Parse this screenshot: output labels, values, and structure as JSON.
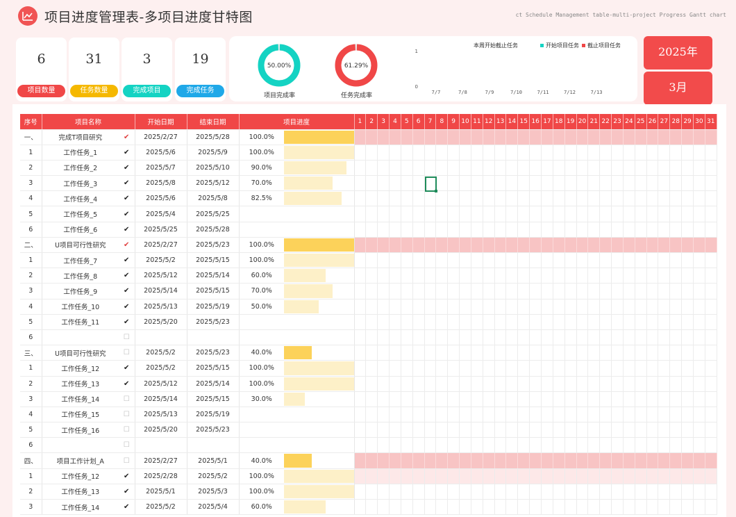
{
  "header": {
    "title": "项目进度管理表-多项目进度甘特图",
    "subtitle": "ct Schedule Management table-multi-project Progress Gantt chart"
  },
  "kpis": [
    {
      "value": "6",
      "label": "项目数量",
      "color": "#f04747"
    },
    {
      "value": "31",
      "label": "任务数量",
      "color": "#f5b800"
    },
    {
      "value": "3",
      "label": "完成项目",
      "color": "#14d3c3"
    },
    {
      "value": "19",
      "label": "完成任务",
      "color": "#1fa8e8"
    }
  ],
  "donuts": [
    {
      "value_text": "50.00%",
      "fraction": 0.5,
      "label": "项目完成率",
      "color": "#14d3c3"
    },
    {
      "value_text": "61.29%",
      "fraction": 0.6129,
      "label": "任务完成率",
      "color": "#f04747"
    }
  ],
  "chart_data": {
    "type": "bar",
    "title": "本周开始截止任务",
    "categories": [
      "7/7",
      "7/8",
      "7/9",
      "7/10",
      "7/11",
      "7/12",
      "7/13"
    ],
    "series": [
      {
        "name": "开始项目任务",
        "values": [
          0,
          0,
          0,
          0,
          0,
          0,
          0
        ],
        "color": "#14d3c3"
      },
      {
        "name": "截止项目任务",
        "values": [
          0,
          0,
          0,
          0,
          0,
          0,
          0
        ],
        "color": "#f04747"
      }
    ],
    "yticks": [
      "1",
      "0"
    ],
    "ylim": [
      0,
      1
    ]
  },
  "date": {
    "year": "2025年",
    "month": "3月"
  },
  "table": {
    "columns": [
      "序号",
      "项目名称",
      "开始日期",
      "结束日期",
      "项目进度"
    ],
    "days": [
      "1",
      "2",
      "3",
      "4",
      "5",
      "6",
      "7",
      "8",
      "9",
      "10",
      "11",
      "12",
      "13",
      "14",
      "15",
      "16",
      "17",
      "18",
      "19",
      "20",
      "21",
      "22",
      "23",
      "24",
      "25",
      "26",
      "27",
      "28",
      "29",
      "30",
      "31"
    ],
    "rows": [
      {
        "idx": "一、",
        "name": "完成T项目研究",
        "check": "✔",
        "check_color": "#e04040",
        "start": "2025/2/27",
        "end": "2025/5/28",
        "pct": "100.0%",
        "progress": 1.0,
        "group": true
      },
      {
        "idx": "1",
        "name": "工作任务_1",
        "check": "✔",
        "start": "2025/5/6",
        "end": "2025/5/9",
        "pct": "100.0%",
        "progress": 1.0
      },
      {
        "idx": "2",
        "name": "工作任务_2",
        "check": "✔",
        "start": "2025/5/7",
        "end": "2025/5/10",
        "pct": "90.0%",
        "progress": 0.9
      },
      {
        "idx": "3",
        "name": "工作任务_3",
        "check": "✔",
        "start": "2025/5/8",
        "end": "2025/5/12",
        "pct": "70.0%",
        "progress": 0.7
      },
      {
        "idx": "4",
        "name": "工作任务_4",
        "check": "✔",
        "start": "2025/5/6",
        "end": "2025/5/8",
        "pct": "82.5%",
        "progress": 0.825
      },
      {
        "idx": "5",
        "name": "工作任务_5",
        "check": "✔",
        "start": "2025/5/4",
        "end": "2025/5/25",
        "pct": "",
        "progress": 0
      },
      {
        "idx": "6",
        "name": "工作任务_6",
        "check": "✔",
        "start": "2025/5/25",
        "end": "2025/5/28",
        "pct": "",
        "progress": 0
      },
      {
        "idx": "二、",
        "name": "U项目可行性研究",
        "check": "✔",
        "check_color": "#e04040",
        "start": "2025/2/27",
        "end": "2025/5/23",
        "pct": "100.0%",
        "progress": 1.0,
        "group": true
      },
      {
        "idx": "1",
        "name": "工作任务_7",
        "check": "✔",
        "start": "2025/5/2",
        "end": "2025/5/15",
        "pct": "100.0%",
        "progress": 1.0
      },
      {
        "idx": "2",
        "name": "工作任务_8",
        "check": "✔",
        "start": "2025/5/12",
        "end": "2025/5/14",
        "pct": "60.0%",
        "progress": 0.6
      },
      {
        "idx": "3",
        "name": "工作任务_9",
        "check": "✔",
        "start": "2025/5/14",
        "end": "2025/5/15",
        "pct": "70.0%",
        "progress": 0.7
      },
      {
        "idx": "4",
        "name": "工作任务_10",
        "check": "✔",
        "start": "2025/5/13",
        "end": "2025/5/19",
        "pct": "50.0%",
        "progress": 0.5
      },
      {
        "idx": "5",
        "name": "工作任务_11",
        "check": "✔",
        "start": "2025/5/20",
        "end": "2025/5/23",
        "pct": "",
        "progress": 0
      },
      {
        "idx": "6",
        "name": "",
        "check": "☐",
        "start": "",
        "end": "",
        "pct": "",
        "progress": 0
      },
      {
        "idx": "三、",
        "name": "U项目可行性研究",
        "check": "☐",
        "start": "2025/5/2",
        "end": "2025/5/23",
        "pct": "40.0%",
        "progress": 0.4,
        "group": true,
        "nogantt": true
      },
      {
        "idx": "1",
        "name": "工作任务_12",
        "check": "✔",
        "start": "2025/5/2",
        "end": "2025/5/15",
        "pct": "100.0%",
        "progress": 1.0
      },
      {
        "idx": "2",
        "name": "工作任务_13",
        "check": "✔",
        "start": "2025/5/12",
        "end": "2025/5/14",
        "pct": "100.0%",
        "progress": 1.0
      },
      {
        "idx": "3",
        "name": "工作任务_14",
        "check": "☐",
        "start": "2025/5/14",
        "end": "2025/5/15",
        "pct": "30.0%",
        "progress": 0.3
      },
      {
        "idx": "4",
        "name": "工作任务_15",
        "check": "☐",
        "start": "2025/5/13",
        "end": "2025/5/19",
        "pct": "",
        "progress": 0
      },
      {
        "idx": "5",
        "name": "工作任务_16",
        "check": "☐",
        "start": "2025/5/20",
        "end": "2025/5/23",
        "pct": "",
        "progress": 0
      },
      {
        "idx": "6",
        "name": "",
        "check": "☐",
        "start": "",
        "end": "",
        "pct": "",
        "progress": 0
      },
      {
        "idx": "四、",
        "name": "项目工作计划_A",
        "check": "☐",
        "start": "2025/2/27",
        "end": "2025/5/1",
        "pct": "40.0%",
        "progress": 0.4,
        "group": true
      },
      {
        "idx": "1",
        "name": "工作任务_12",
        "check": "✔",
        "start": "2025/2/28",
        "end": "2025/5/2",
        "pct": "100.0%",
        "progress": 1.0,
        "lightgantt": true
      },
      {
        "idx": "2",
        "name": "工作任务_13",
        "check": "✔",
        "start": "2025/5/1",
        "end": "2025/5/3",
        "pct": "100.0%",
        "progress": 1.0
      },
      {
        "idx": "3",
        "name": "工作任务_14",
        "check": "✔",
        "start": "2025/5/2",
        "end": "2025/5/4",
        "pct": "60.0%",
        "progress": 0.6
      }
    ]
  },
  "colors": {
    "accent": "#f04747",
    "bar_group": "#fcd25a",
    "bar_task": "#fdf0c8",
    "gantt_group": "#f8c4c4"
  }
}
